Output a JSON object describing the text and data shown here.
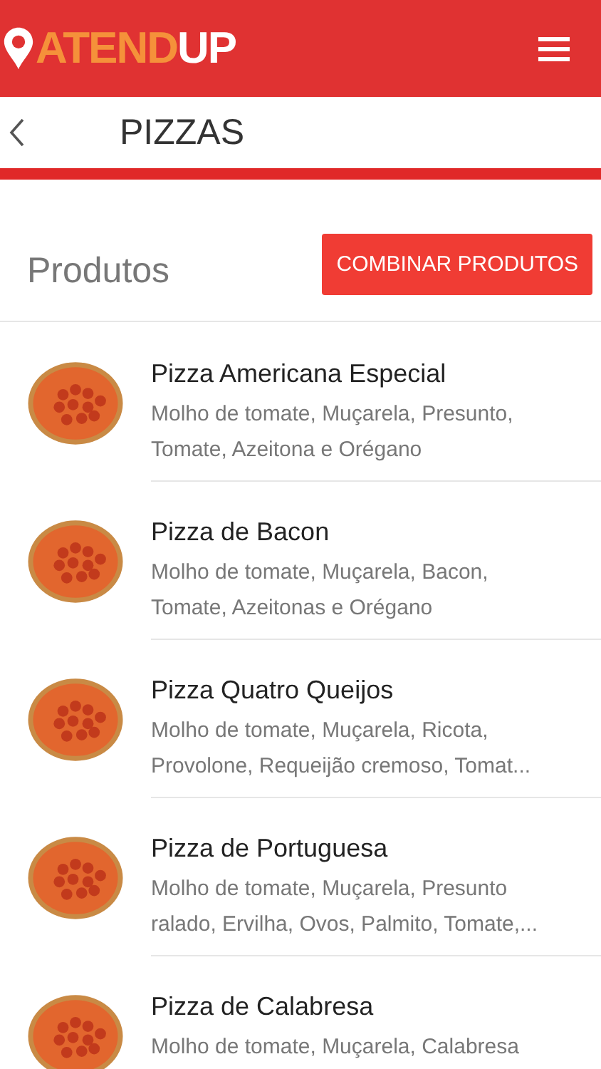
{
  "header": {
    "logo": [
      {
        "text": "ATEND",
        "color": "#f5913a"
      },
      {
        "text": "UP",
        "color": "#ffffff"
      }
    ]
  },
  "page": {
    "title": "PIZZAS"
  },
  "section": {
    "title": "Produtos",
    "button": "COMBINAR PRODUTOS"
  },
  "products": [
    {
      "name": "Pizza Americana Especial",
      "description": "Molho de tomate, Muçarela, Presunto, Tomate, Azeitona e Orégano"
    },
    {
      "name": "Pizza de Bacon",
      "description": "Molho de tomate, Muçarela, Bacon, Tomate, Azeitonas e Orégano"
    },
    {
      "name": "Pizza Quatro Queijos",
      "description": "Molho de tomate, Muçarela, Ricota, Provolone, Requeijão cremoso, Tomat..."
    },
    {
      "name": "Pizza de Portuguesa",
      "description": "Molho de tomate, Muçarela, Presunto ralado, Ervilha, Ovos, Palmito, Tomate,..."
    },
    {
      "name": "Pizza de Calabresa",
      "description": "Molho de tomate, Muçarela, Calabresa"
    }
  ]
}
